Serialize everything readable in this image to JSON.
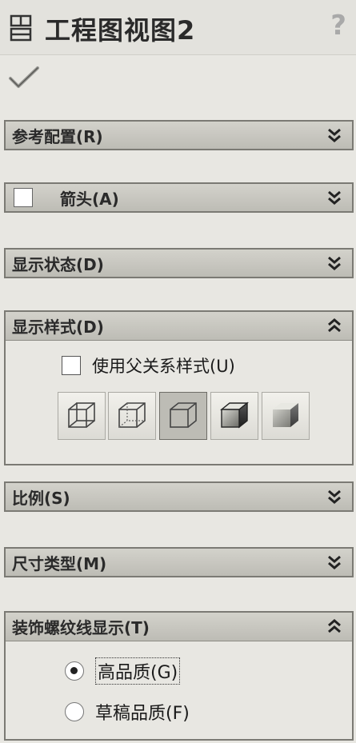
{
  "title": "工程图视图2",
  "help_label": "?",
  "sections": {
    "ref_config": "参考配置(R)",
    "arrow": "箭头(A)",
    "display_state": "显示状态(D)",
    "display_style": "显示样式(D)",
    "scale": "比例(S)",
    "dimension_type": "尺寸类型(M)",
    "cosmetic_thread": "装饰螺纹线显示(T)"
  },
  "display_style": {
    "use_parent_label": "使用父关系样式(U)",
    "use_parent_checked": false,
    "selected_index": 2,
    "buttons": [
      "wireframe-icon",
      "hidden-lines-visible-icon",
      "hidden-lines-removed-icon",
      "shaded-with-edges-icon",
      "shaded-icon"
    ]
  },
  "cosmetic_thread": {
    "options": [
      "高品质(G)",
      "草稿品质(F)"
    ],
    "selected_index": 0
  },
  "arrow_checked": false,
  "colors": {
    "panel": "#e8e7e2",
    "header": "#c6c5be",
    "border": "#7b7a74"
  }
}
